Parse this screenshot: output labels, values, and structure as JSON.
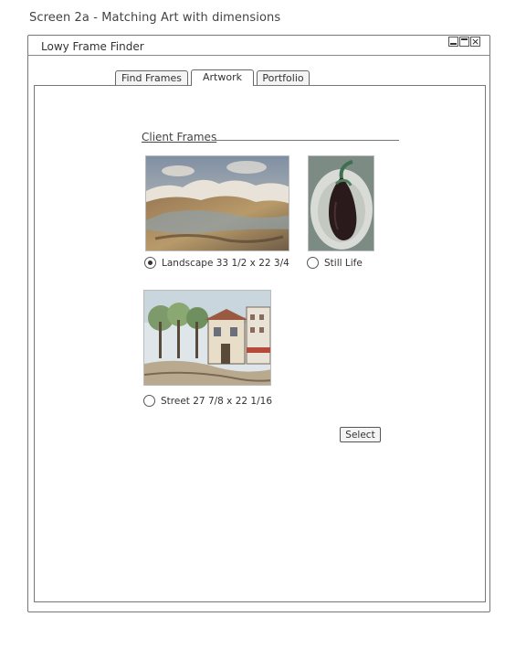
{
  "screen_title": "Screen 2a - Matching Art with dimensions",
  "window": {
    "title": "Lowy Frame Finder",
    "controls": {
      "minimize": "",
      "maximize": "",
      "close": "×"
    }
  },
  "tabs": [
    {
      "label": "Find Frames",
      "active": false
    },
    {
      "label": "Artwork",
      "active": true
    },
    {
      "label": "Portfolio",
      "active": false
    }
  ],
  "section": {
    "title": "Client Frames"
  },
  "artworks": [
    {
      "label": "Landscape 33 1/2 x 22 3/4",
      "selected": true
    },
    {
      "label": "Still Life",
      "selected": false
    },
    {
      "label": "Street 27 7/8 x 22 1/16",
      "selected": false
    }
  ],
  "select_button": {
    "label": "Select"
  }
}
